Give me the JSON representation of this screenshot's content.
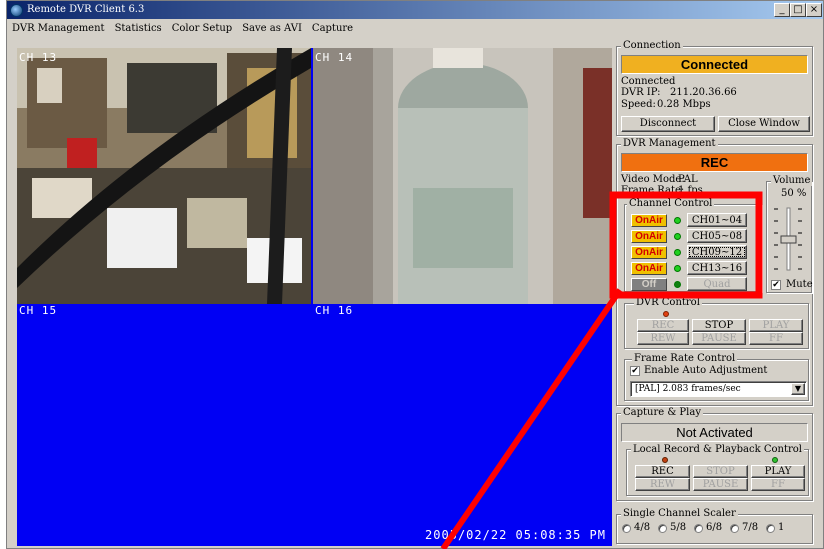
{
  "window": {
    "title": "Remote DVR Client 6.3",
    "minimize": "_",
    "maximize": "□",
    "close": "×"
  },
  "menu": [
    "DVR Management",
    "Statistics",
    "Color Setup",
    "Save as AVI",
    "Capture"
  ],
  "video": {
    "channels": [
      "CH 13",
      "CH 14",
      "CH 15",
      "CH 16"
    ],
    "timestamp": "2005/02/22 05:08:35 PM"
  },
  "connection": {
    "title": "Connection",
    "status": "Connected",
    "status_text": "Connected",
    "dvr_ip_label": "DVR IP:",
    "dvr_ip": "211.20.36.66",
    "speed_label": "Speed:",
    "speed": "0.28 Mbps",
    "disconnect": "Disconnect",
    "close_window": "Close Window",
    "status_color": "#f0b020"
  },
  "dvr_management": {
    "title": "DVR Management",
    "status": "REC",
    "status_color": "#f07010",
    "video_mode_label": "Video Mode:",
    "video_mode": "PAL",
    "frame_rate_label": "Frame Rate:",
    "frame_rate": "1 fps",
    "channel_control": {
      "title": "Channel Control",
      "onair": [
        "OnAir",
        "OnAir",
        "OnAir",
        "OnAir"
      ],
      "off": "Off",
      "groups": [
        "CH01~04",
        "CH05~08",
        "CH09~12",
        "CH13~16"
      ],
      "quad": "Quad"
    },
    "volume": {
      "title": "Volume",
      "value": "50 %",
      "level": 0.5,
      "mute_label": "Mute",
      "muted": true
    }
  },
  "dvr_control": {
    "title": "DVR Control",
    "buttons": [
      "REC",
      "STOP",
      "PLAY",
      "REW",
      "PAUSE",
      "FF"
    ]
  },
  "frame_rate_control": {
    "title": "Frame Rate Control",
    "auto_label": "Enable Auto Adjustment",
    "auto_checked": true,
    "selected": "[PAL] 2.083 frames/sec"
  },
  "capture_play": {
    "title": "Capture & Play",
    "status": "Not Activated",
    "local_title": "Local Record & Playback Control",
    "buttons": [
      "REC",
      "STOP",
      "PLAY",
      "REW",
      "PAUSE",
      "FF"
    ]
  },
  "scaler": {
    "title": "Single Channel Scaler",
    "options": [
      "4/8",
      "5/8",
      "6/8",
      "7/8",
      "1"
    ]
  },
  "annotation": {
    "color": "#ff0000"
  }
}
